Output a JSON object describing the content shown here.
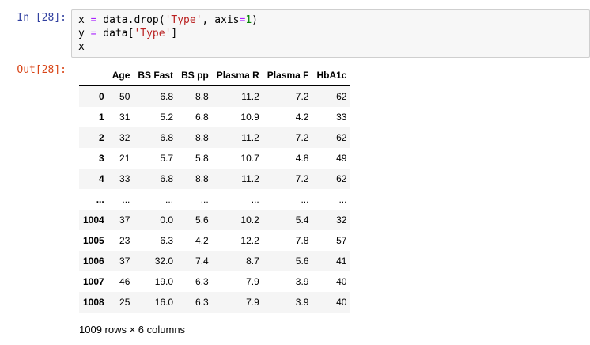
{
  "cell": {
    "in_prompt": "In [28]:",
    "out_prompt": "Out[28]:",
    "code_lines": [
      {
        "parts": [
          [
            "x ",
            ""
          ],
          [
            "=",
            "eq"
          ],
          [
            " data.drop(",
            ""
          ],
          [
            "'Type'",
            "str"
          ],
          [
            ", axis",
            ""
          ],
          [
            "=",
            "eq"
          ],
          [
            "1",
            "num"
          ],
          [
            ")",
            ""
          ]
        ]
      },
      {
        "parts": [
          [
            "y ",
            ""
          ],
          [
            "=",
            "eq"
          ],
          [
            " data[",
            ""
          ],
          [
            "'Type'",
            "str"
          ],
          [
            "]",
            ""
          ]
        ]
      },
      {
        "parts": [
          [
            "x",
            ""
          ]
        ]
      }
    ]
  },
  "dataframe": {
    "columns": [
      "Age",
      "BS Fast",
      "BS pp",
      "Plasma R",
      "Plasma F",
      "HbA1c"
    ],
    "rows": [
      {
        "index": "0",
        "values": [
          "50",
          "6.8",
          "8.8",
          "11.2",
          "7.2",
          "62"
        ]
      },
      {
        "index": "1",
        "values": [
          "31",
          "5.2",
          "6.8",
          "10.9",
          "4.2",
          "33"
        ]
      },
      {
        "index": "2",
        "values": [
          "32",
          "6.8",
          "8.8",
          "11.2",
          "7.2",
          "62"
        ]
      },
      {
        "index": "3",
        "values": [
          "21",
          "5.7",
          "5.8",
          "10.7",
          "4.8",
          "49"
        ]
      },
      {
        "index": "4",
        "values": [
          "33",
          "6.8",
          "8.8",
          "11.2",
          "7.2",
          "62"
        ]
      },
      {
        "index": "...",
        "values": [
          "...",
          "...",
          "...",
          "...",
          "...",
          "..."
        ]
      },
      {
        "index": "1004",
        "values": [
          "37",
          "0.0",
          "5.6",
          "10.2",
          "5.4",
          "32"
        ]
      },
      {
        "index": "1005",
        "values": [
          "23",
          "6.3",
          "4.2",
          "12.2",
          "7.8",
          "57"
        ]
      },
      {
        "index": "1006",
        "values": [
          "37",
          "32.0",
          "7.4",
          "8.7",
          "5.6",
          "41"
        ]
      },
      {
        "index": "1007",
        "values": [
          "46",
          "19.0",
          "6.3",
          "7.9",
          "3.9",
          "40"
        ]
      },
      {
        "index": "1008",
        "values": [
          "25",
          "16.0",
          "6.3",
          "7.9",
          "3.9",
          "40"
        ]
      }
    ],
    "summary": "1009 rows × 6 columns"
  }
}
